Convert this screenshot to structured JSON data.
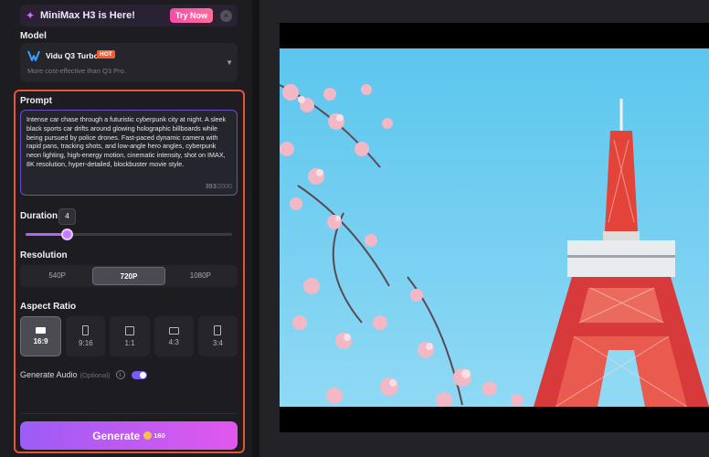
{
  "banner": {
    "title": "MiniMax H3 is Here!",
    "cta": "Try Now",
    "close": "×"
  },
  "model": {
    "section_label": "Model",
    "name": "Vidu Q3 Turbo",
    "badge": "HOT",
    "subtitle": "More cost-effective than Q3 Pro.",
    "dropdown_icon": "▼"
  },
  "prompt": {
    "section_label": "Prompt",
    "text": "Intense car chase through a futuristic cyberpunk city at night. A sleek black sports car drifts around glowing holographic billboards while being pursued by police drones. Fast-paced dynamic camera with rapid pans, tracking shots, and low-angle hero angles, cyberpunk neon lighting, high-energy motion, cinematic intensity, shot on IMAX, 8K resolution, hyper-detailed, blockbuster movie style.",
    "char_count": "393",
    "char_max": "/2000"
  },
  "duration": {
    "section_label": "Duration",
    "value": "4",
    "slider_fraction": 0.2
  },
  "resolution": {
    "section_label": "Resolution",
    "options": [
      "540P",
      "720P",
      "1080P"
    ],
    "selected": "720P"
  },
  "aspect_ratio": {
    "section_label": "Aspect Ratio",
    "options": [
      "16:9",
      "9:16",
      "1:1",
      "4:3",
      "3:4"
    ],
    "selected": "16:9"
  },
  "audio": {
    "label": "Generate Audio",
    "optional": "(Optional)",
    "info_icon": "i",
    "enabled": true
  },
  "generate": {
    "label": "Generate",
    "cost": "160"
  },
  "colors": {
    "accent": "#b164f5",
    "highlight_border": "#e8552f",
    "hot_badge": "#ff5a2c",
    "toggle": "#7a5cf5"
  },
  "preview": {
    "icon_names": [
      "video-preview"
    ]
  }
}
